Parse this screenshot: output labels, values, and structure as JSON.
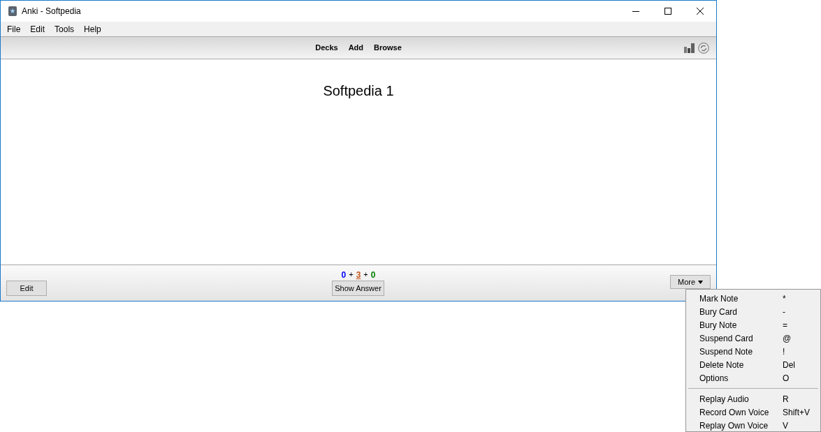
{
  "window": {
    "title": "Anki - Softpedia"
  },
  "menu_bar": [
    "File",
    "Edit",
    "Tools",
    "Help"
  ],
  "toolbar": {
    "links": [
      "Decks",
      "Add",
      "Browse"
    ]
  },
  "card": {
    "question": "Softpedia 1"
  },
  "count_separators": [
    "+",
    "+"
  ],
  "counts": [
    {
      "value": "0",
      "color": "#0000ff",
      "selected": false
    },
    {
      "value": "3",
      "color": "#c35617",
      "selected": true
    },
    {
      "value": "0",
      "color": "#008000",
      "selected": false
    }
  ],
  "bottom_bar": {
    "edit_button": "Edit",
    "show_answer_button": "Show Answer",
    "more_button": "More"
  },
  "more_menu": [
    [
      {
        "label": "Mark Note",
        "shortcut": "*"
      },
      {
        "label": "Bury Card",
        "shortcut": "-"
      },
      {
        "label": "Bury Note",
        "shortcut": "="
      },
      {
        "label": "Suspend Card",
        "shortcut": "@"
      },
      {
        "label": "Suspend Note",
        "shortcut": "!"
      },
      {
        "label": "Delete Note",
        "shortcut": "Del"
      },
      {
        "label": "Options",
        "shortcut": "O"
      }
    ],
    [
      {
        "label": "Replay Audio",
        "shortcut": "R"
      },
      {
        "label": "Record Own Voice",
        "shortcut": "Shift+V"
      },
      {
        "label": "Replay Own Voice",
        "shortcut": "V"
      }
    ]
  ]
}
